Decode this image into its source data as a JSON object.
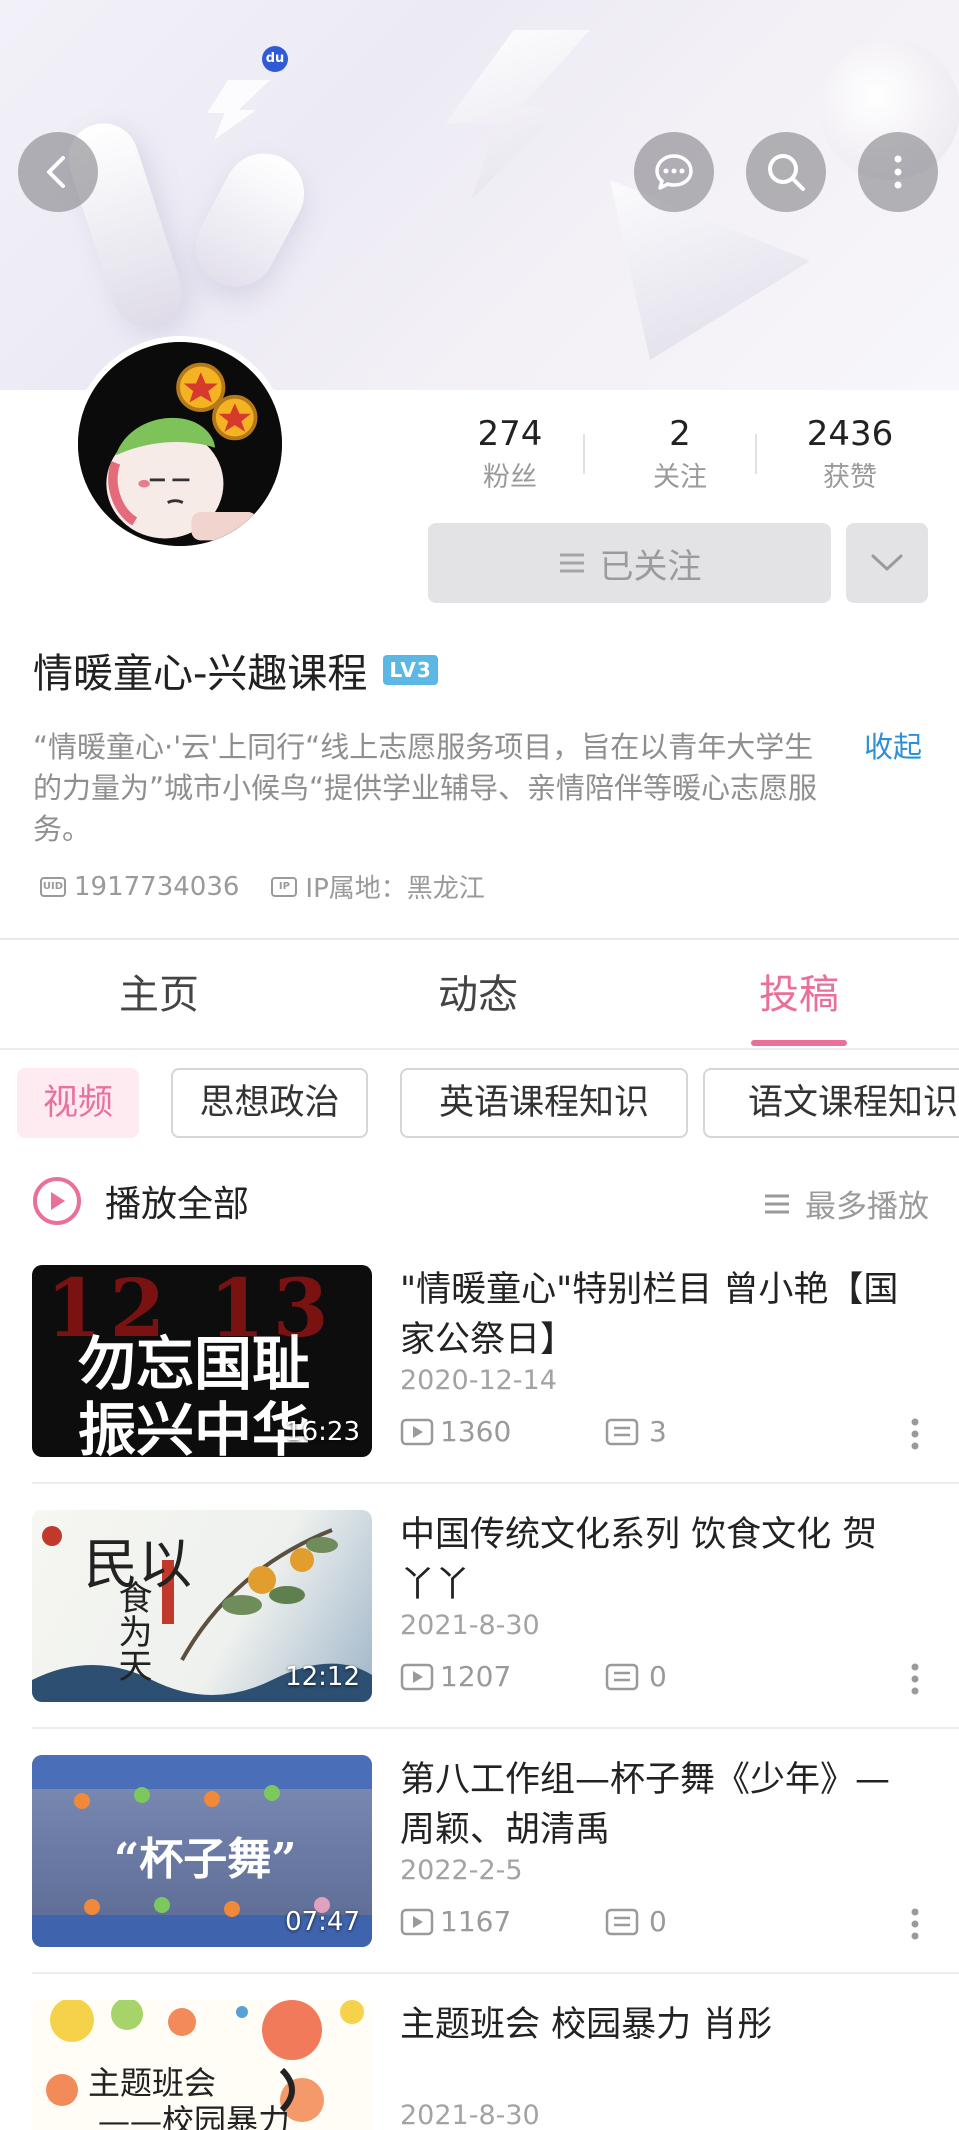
{
  "status_bar": {
    "app_badge": "du"
  },
  "profile": {
    "stats": [
      {
        "value": "274",
        "label": "粉丝"
      },
      {
        "value": "2",
        "label": "关注"
      },
      {
        "value": "2436",
        "label": "获赞"
      }
    ],
    "follow_button": "已关注",
    "name": "情暖童心-兴趣课程",
    "level_badge": "LV3",
    "bio": "“情暖童心·'云'上同行“线上志愿服务项目，旨在以青年大学生的力量为”城市小候鸟“提供学业辅导、亲情陪伴等暖心志愿服务。",
    "collapse_link": "收起",
    "uid_icon": "UID",
    "uid": "1917734036",
    "ip_icon": "IP",
    "ip_location": "IP属地：黑龙江"
  },
  "tabs": [
    {
      "label": "主页",
      "active": false
    },
    {
      "label": "动态",
      "active": false
    },
    {
      "label": "投稿",
      "active": true
    }
  ],
  "categories": [
    {
      "label": "视频",
      "active": true
    },
    {
      "label": "思想政治",
      "active": false
    },
    {
      "label": "英语课程知识",
      "active": false
    },
    {
      "label": "语文课程知识",
      "active": false
    }
  ],
  "play_all": "播放全部",
  "sort_label": "最多播放",
  "videos": [
    {
      "title": "\"情暖童心\"特别栏目 曾小艳【国家公祭日】",
      "date": "2020-12-14",
      "duration": "16:23",
      "plays": "1360",
      "comments": "3",
      "thumb_text": [
        "勿忘国耻",
        "振兴中华"
      ],
      "thumb_numbers": "12 13"
    },
    {
      "title": "中国传统文化系列 饮食文化 贺丫丫",
      "date": "2021-8-30",
      "duration": "12:12",
      "plays": "1207",
      "comments": "0",
      "thumb_text": [
        "民以",
        "食为天"
      ]
    },
    {
      "title": "第八工作组—杯子舞《少年》—周颖、胡清禹",
      "date": "2022-2-5",
      "duration": "07:47",
      "plays": "1167",
      "comments": "0",
      "thumb_text": [
        "“杯子舞”"
      ]
    },
    {
      "title": "主题班会 校园暴力 肖彤",
      "date": "2021-8-30",
      "thumb_text": [
        "主题班会",
        "——校园暴力"
      ]
    }
  ],
  "colors": {
    "accent_pink": "#ea6f9b",
    "link_blue": "#2f8fd5",
    "level_badge": "#5cb7e5"
  },
  "icons": [
    "back-icon",
    "message-icon",
    "search-icon",
    "more-vertical-icon",
    "chevron-down-icon",
    "play-icon",
    "list-icon",
    "comment-icon"
  ]
}
